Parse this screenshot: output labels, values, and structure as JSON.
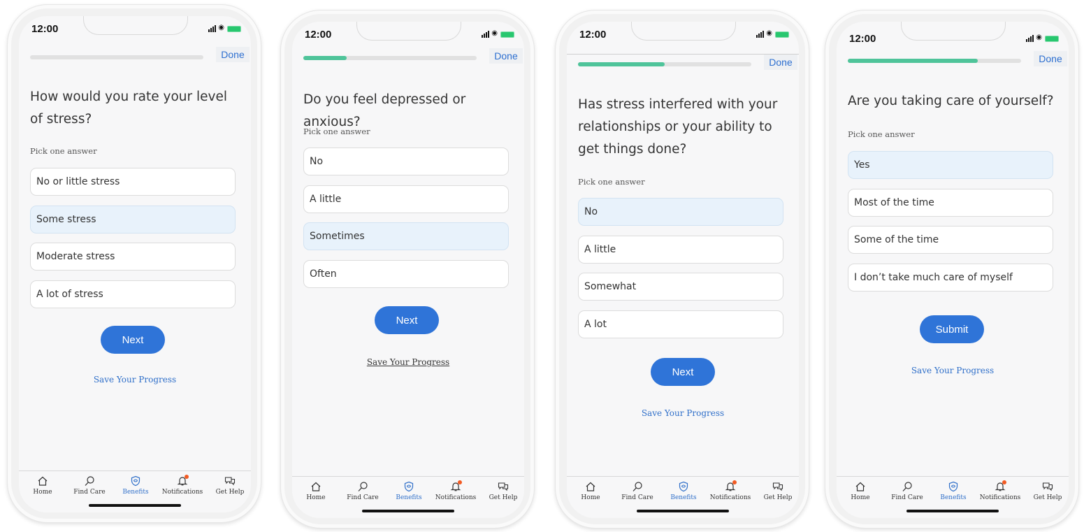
{
  "screens": [
    {
      "time": "12:00",
      "done_label": "Done",
      "progress": 0,
      "question": "How would you rate your level of stress?",
      "instruction": "Pick one answer",
      "answers": [
        "No or little stress",
        "Some stress",
        "Moderate stress",
        "A lot of stress"
      ],
      "selected_answer": "Some stress",
      "cta_label": "Next",
      "save_label": "Save Your Progress"
    },
    {
      "time": "12:00",
      "done_label": "Done",
      "progress": 0.25,
      "question": "Do you feel depressed or anxious?",
      "instruction": "Pick one answer",
      "answers": [
        "No",
        "A little",
        "Sometimes",
        "Often"
      ],
      "selected_answer": "Sometimes",
      "cta_label": "Next",
      "save_label": "Save Your Progress"
    },
    {
      "time": "12:00",
      "done_label": "Done",
      "progress": 0.5,
      "question": "Has stress interfered with your relationships or your ability to get things done?",
      "instruction": "Pick one answer",
      "answers": [
        "No",
        "A little",
        "Somewhat",
        "A lot"
      ],
      "selected_answer": "No",
      "cta_label": "Next",
      "save_label": "Save Your Progress"
    },
    {
      "time": "12:00",
      "done_label": "Done",
      "progress": 0.75,
      "question": "Are you taking care of yourself?",
      "instruction": "Pick one answer",
      "answers": [
        "Yes",
        "Most of the time",
        "Some of the time",
        "I don’t take much care of myself"
      ],
      "selected_answer": "Yes",
      "cta_label": "Submit",
      "save_label": "Save Your Progress"
    }
  ],
  "tabbar": {
    "active": "Benefits",
    "items": [
      {
        "label": "Home",
        "icon": "home-icon"
      },
      {
        "label": "Find Care",
        "icon": "search-icon"
      },
      {
        "label": "Benefits",
        "icon": "shield-icon"
      },
      {
        "label": "Notifications",
        "icon": "bell-icon"
      },
      {
        "label": "Get Help",
        "icon": "chat-icon"
      }
    ]
  },
  "colors": {
    "accent": "#2f74d8",
    "progress": "#4fc49a",
    "selected_bg": "#e8f2fb",
    "notification_dot": "#f25a22"
  }
}
